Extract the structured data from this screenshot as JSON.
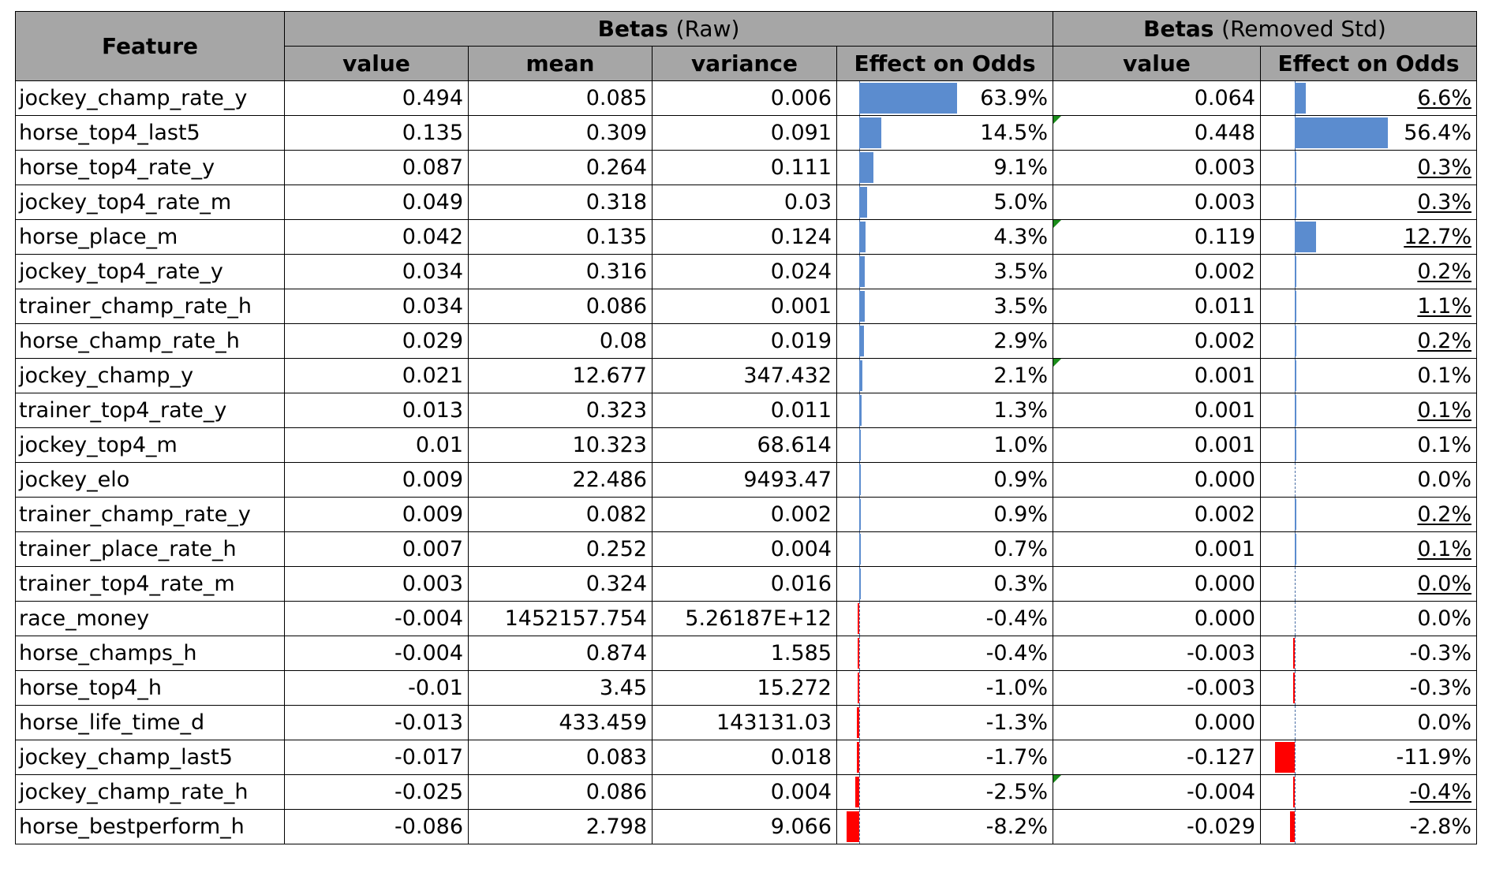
{
  "header": {
    "feature_label": "Feature",
    "group_raw_title": "Betas",
    "group_raw_sub": "(Raw)",
    "group_std_title": "Betas",
    "group_std_sub": "(Removed Std)",
    "col_value": "value",
    "col_mean": "mean",
    "col_variance": "variance",
    "col_effect": "Effect on Odds",
    "col_value_std": "value",
    "col_effect_std": "Effect on Odds"
  },
  "colors": {
    "header_bg": "#a6a6a6",
    "positive_bar": "#5b8ccf",
    "negative_bar": "#ff0000",
    "comment_marker": "#1a8c1a"
  },
  "rows": [
    {
      "feature": "jockey_champ_rate_y",
      "value": "0.494",
      "mean": "0.085",
      "variance": "0.006",
      "effect": "63.9%",
      "effect_num": 63.9,
      "value_std": "0.064",
      "effect_std": "6.6%",
      "effect_std_num": 6.6,
      "std_underline": true,
      "marker_effect": false
    },
    {
      "feature": "horse_top4_last5",
      "value": "0.135",
      "mean": "0.309",
      "variance": "0.091",
      "effect": "14.5%",
      "effect_num": 14.5,
      "value_std": "0.448",
      "effect_std": "56.4%",
      "effect_std_num": 56.4,
      "std_underline": false,
      "marker_effect": true
    },
    {
      "feature": "horse_top4_rate_y",
      "value": "0.087",
      "mean": "0.264",
      "variance": "0.111",
      "effect": "9.1%",
      "effect_num": 9.1,
      "value_std": "0.003",
      "effect_std": "0.3%",
      "effect_std_num": 0.3,
      "std_underline": true,
      "marker_effect": false
    },
    {
      "feature": "jockey_top4_rate_m",
      "value": "0.049",
      "mean": "0.318",
      "variance": "0.03",
      "effect": "5.0%",
      "effect_num": 5.0,
      "value_std": "0.003",
      "effect_std": "0.3%",
      "effect_std_num": 0.3,
      "std_underline": true,
      "marker_effect": false
    },
    {
      "feature": "horse_place_m",
      "value": "0.042",
      "mean": "0.135",
      "variance": "0.124",
      "effect": "4.3%",
      "effect_num": 4.3,
      "value_std": "0.119",
      "effect_std": "12.7%",
      "effect_std_num": 12.7,
      "std_underline": true,
      "marker_effect": true
    },
    {
      "feature": "jockey_top4_rate_y",
      "value": "0.034",
      "mean": "0.316",
      "variance": "0.024",
      "effect": "3.5%",
      "effect_num": 3.5,
      "value_std": "0.002",
      "effect_std": "0.2%",
      "effect_std_num": 0.2,
      "std_underline": true,
      "marker_effect": false
    },
    {
      "feature": "trainer_champ_rate_h",
      "value": "0.034",
      "mean": "0.086",
      "variance": "0.001",
      "effect": "3.5%",
      "effect_num": 3.5,
      "value_std": "0.011",
      "effect_std": "1.1%",
      "effect_std_num": 1.1,
      "std_underline": true,
      "marker_effect": false
    },
    {
      "feature": "horse_champ_rate_h",
      "value": "0.029",
      "mean": "0.08",
      "variance": "0.019",
      "effect": "2.9%",
      "effect_num": 2.9,
      "value_std": "0.002",
      "effect_std": "0.2%",
      "effect_std_num": 0.2,
      "std_underline": true,
      "marker_effect": false
    },
    {
      "feature": "jockey_champ_y",
      "value": "0.021",
      "mean": "12.677",
      "variance": "347.432",
      "effect": "2.1%",
      "effect_num": 2.1,
      "value_std": "0.001",
      "effect_std": "0.1%",
      "effect_std_num": 0.1,
      "std_underline": false,
      "marker_effect": true
    },
    {
      "feature": "trainer_top4_rate_y",
      "value": "0.013",
      "mean": "0.323",
      "variance": "0.011",
      "effect": "1.3%",
      "effect_num": 1.3,
      "value_std": "0.001",
      "effect_std": "0.1%",
      "effect_std_num": 0.1,
      "std_underline": true,
      "marker_effect": false
    },
    {
      "feature": "jockey_top4_m",
      "value": "0.01",
      "mean": "10.323",
      "variance": "68.614",
      "effect": "1.0%",
      "effect_num": 1.0,
      "value_std": "0.001",
      "effect_std": "0.1%",
      "effect_std_num": 0.1,
      "std_underline": false,
      "marker_effect": false
    },
    {
      "feature": "jockey_elo",
      "value": "0.009",
      "mean": "22.486",
      "variance": "9493.47",
      "effect": "0.9%",
      "effect_num": 0.9,
      "value_std": "0.000",
      "effect_std": "0.0%",
      "effect_std_num": 0.0,
      "std_underline": false,
      "marker_effect": false
    },
    {
      "feature": "trainer_champ_rate_y",
      "value": "0.009",
      "mean": "0.082",
      "variance": "0.002",
      "effect": "0.9%",
      "effect_num": 0.9,
      "value_std": "0.002",
      "effect_std": "0.2%",
      "effect_std_num": 0.2,
      "std_underline": true,
      "marker_effect": false
    },
    {
      "feature": "trainer_place_rate_h",
      "value": "0.007",
      "mean": "0.252",
      "variance": "0.004",
      "effect": "0.7%",
      "effect_num": 0.7,
      "value_std": "0.001",
      "effect_std": "0.1%",
      "effect_std_num": 0.1,
      "std_underline": true,
      "marker_effect": false
    },
    {
      "feature": "trainer_top4_rate_m",
      "value": "0.003",
      "mean": "0.324",
      "variance": "0.016",
      "effect": "0.3%",
      "effect_num": 0.3,
      "value_std": "0.000",
      "effect_std": "0.0%",
      "effect_std_num": 0.0,
      "std_underline": true,
      "marker_effect": false
    },
    {
      "feature": "race_money",
      "value": "-0.004",
      "mean": "1452157.754",
      "variance": "5.26187E+12",
      "effect": "-0.4%",
      "effect_num": -0.4,
      "value_std": "0.000",
      "effect_std": "0.0%",
      "effect_std_num": 0.0,
      "std_underline": false,
      "marker_effect": false
    },
    {
      "feature": "horse_champs_h",
      "value": "-0.004",
      "mean": "0.874",
      "variance": "1.585",
      "effect": "-0.4%",
      "effect_num": -0.4,
      "value_std": "-0.003",
      "effect_std": "-0.3%",
      "effect_std_num": -0.3,
      "std_underline": false,
      "marker_effect": false
    },
    {
      "feature": "horse_top4_h",
      "value": "-0.01",
      "mean": "3.45",
      "variance": "15.272",
      "effect": "-1.0%",
      "effect_num": -1.0,
      "value_std": "-0.003",
      "effect_std": "-0.3%",
      "effect_std_num": -0.3,
      "std_underline": false,
      "marker_effect": false
    },
    {
      "feature": "horse_life_time_d",
      "value": "-0.013",
      "mean": "433.459",
      "variance": "143131.03",
      "effect": "-1.3%",
      "effect_num": -1.3,
      "value_std": "0.000",
      "effect_std": "0.0%",
      "effect_std_num": 0.0,
      "std_underline": false,
      "marker_effect": false
    },
    {
      "feature": "jockey_champ_last5",
      "value": "-0.017",
      "mean": "0.083",
      "variance": "0.018",
      "effect": "-1.7%",
      "effect_num": -1.7,
      "value_std": "-0.127",
      "effect_std": "-11.9%",
      "effect_std_num": -11.9,
      "std_underline": false,
      "marker_effect": false
    },
    {
      "feature": "jockey_champ_rate_h",
      "value": "-0.025",
      "mean": "0.086",
      "variance": "0.004",
      "effect": "-2.5%",
      "effect_num": -2.5,
      "value_std": "-0.004",
      "effect_std": "-0.4%",
      "effect_std_num": -0.4,
      "std_underline": true,
      "marker_effect": true
    },
    {
      "feature": "horse_bestperform_h",
      "value": "-0.086",
      "mean": "2.798",
      "variance": "9.066",
      "effect": "-8.2%",
      "effect_num": -8.2,
      "value_std": "-0.029",
      "effect_std": "-2.8%",
      "effect_std_num": -2.8,
      "std_underline": false,
      "marker_effect": false
    }
  ]
}
